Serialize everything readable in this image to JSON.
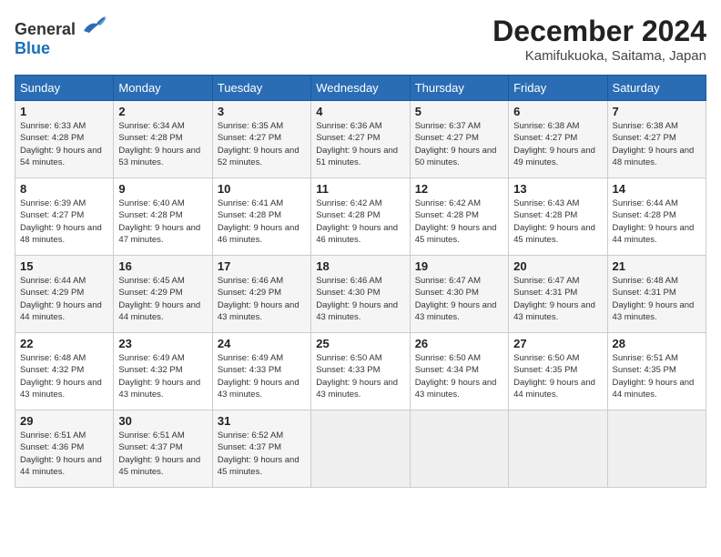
{
  "header": {
    "logo_general": "General",
    "logo_blue": "Blue",
    "month_title": "December 2024",
    "location": "Kamifukuoka, Saitama, Japan"
  },
  "weekdays": [
    "Sunday",
    "Monday",
    "Tuesday",
    "Wednesday",
    "Thursday",
    "Friday",
    "Saturday"
  ],
  "weeks": [
    [
      {
        "day": "1",
        "sunrise": "6:33 AM",
        "sunset": "4:28 PM",
        "daylight": "9 hours and 54 minutes."
      },
      {
        "day": "2",
        "sunrise": "6:34 AM",
        "sunset": "4:28 PM",
        "daylight": "9 hours and 53 minutes."
      },
      {
        "day": "3",
        "sunrise": "6:35 AM",
        "sunset": "4:27 PM",
        "daylight": "9 hours and 52 minutes."
      },
      {
        "day": "4",
        "sunrise": "6:36 AM",
        "sunset": "4:27 PM",
        "daylight": "9 hours and 51 minutes."
      },
      {
        "day": "5",
        "sunrise": "6:37 AM",
        "sunset": "4:27 PM",
        "daylight": "9 hours and 50 minutes."
      },
      {
        "day": "6",
        "sunrise": "6:38 AM",
        "sunset": "4:27 PM",
        "daylight": "9 hours and 49 minutes."
      },
      {
        "day": "7",
        "sunrise": "6:38 AM",
        "sunset": "4:27 PM",
        "daylight": "9 hours and 48 minutes."
      }
    ],
    [
      {
        "day": "8",
        "sunrise": "6:39 AM",
        "sunset": "4:27 PM",
        "daylight": "9 hours and 48 minutes."
      },
      {
        "day": "9",
        "sunrise": "6:40 AM",
        "sunset": "4:28 PM",
        "daylight": "9 hours and 47 minutes."
      },
      {
        "day": "10",
        "sunrise": "6:41 AM",
        "sunset": "4:28 PM",
        "daylight": "9 hours and 46 minutes."
      },
      {
        "day": "11",
        "sunrise": "6:42 AM",
        "sunset": "4:28 PM",
        "daylight": "9 hours and 46 minutes."
      },
      {
        "day": "12",
        "sunrise": "6:42 AM",
        "sunset": "4:28 PM",
        "daylight": "9 hours and 45 minutes."
      },
      {
        "day": "13",
        "sunrise": "6:43 AM",
        "sunset": "4:28 PM",
        "daylight": "9 hours and 45 minutes."
      },
      {
        "day": "14",
        "sunrise": "6:44 AM",
        "sunset": "4:28 PM",
        "daylight": "9 hours and 44 minutes."
      }
    ],
    [
      {
        "day": "15",
        "sunrise": "6:44 AM",
        "sunset": "4:29 PM",
        "daylight": "9 hours and 44 minutes."
      },
      {
        "day": "16",
        "sunrise": "6:45 AM",
        "sunset": "4:29 PM",
        "daylight": "9 hours and 44 minutes."
      },
      {
        "day": "17",
        "sunrise": "6:46 AM",
        "sunset": "4:29 PM",
        "daylight": "9 hours and 43 minutes."
      },
      {
        "day": "18",
        "sunrise": "6:46 AM",
        "sunset": "4:30 PM",
        "daylight": "9 hours and 43 minutes."
      },
      {
        "day": "19",
        "sunrise": "6:47 AM",
        "sunset": "4:30 PM",
        "daylight": "9 hours and 43 minutes."
      },
      {
        "day": "20",
        "sunrise": "6:47 AM",
        "sunset": "4:31 PM",
        "daylight": "9 hours and 43 minutes."
      },
      {
        "day": "21",
        "sunrise": "6:48 AM",
        "sunset": "4:31 PM",
        "daylight": "9 hours and 43 minutes."
      }
    ],
    [
      {
        "day": "22",
        "sunrise": "6:48 AM",
        "sunset": "4:32 PM",
        "daylight": "9 hours and 43 minutes."
      },
      {
        "day": "23",
        "sunrise": "6:49 AM",
        "sunset": "4:32 PM",
        "daylight": "9 hours and 43 minutes."
      },
      {
        "day": "24",
        "sunrise": "6:49 AM",
        "sunset": "4:33 PM",
        "daylight": "9 hours and 43 minutes."
      },
      {
        "day": "25",
        "sunrise": "6:50 AM",
        "sunset": "4:33 PM",
        "daylight": "9 hours and 43 minutes."
      },
      {
        "day": "26",
        "sunrise": "6:50 AM",
        "sunset": "4:34 PM",
        "daylight": "9 hours and 43 minutes."
      },
      {
        "day": "27",
        "sunrise": "6:50 AM",
        "sunset": "4:35 PM",
        "daylight": "9 hours and 44 minutes."
      },
      {
        "day": "28",
        "sunrise": "6:51 AM",
        "sunset": "4:35 PM",
        "daylight": "9 hours and 44 minutes."
      }
    ],
    [
      {
        "day": "29",
        "sunrise": "6:51 AM",
        "sunset": "4:36 PM",
        "daylight": "9 hours and 44 minutes."
      },
      {
        "day": "30",
        "sunrise": "6:51 AM",
        "sunset": "4:37 PM",
        "daylight": "9 hours and 45 minutes."
      },
      {
        "day": "31",
        "sunrise": "6:52 AM",
        "sunset": "4:37 PM",
        "daylight": "9 hours and 45 minutes."
      },
      null,
      null,
      null,
      null
    ]
  ]
}
